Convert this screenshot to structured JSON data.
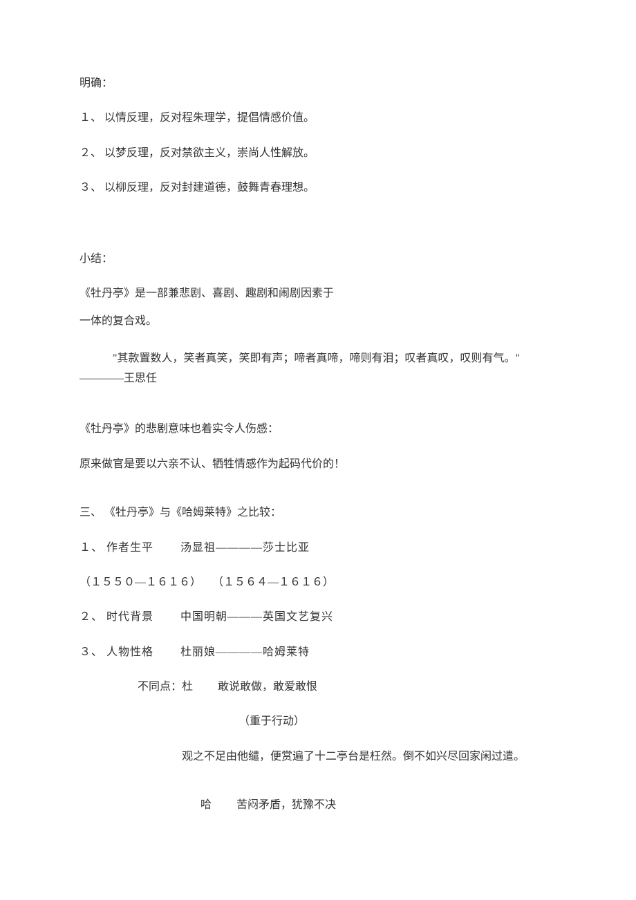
{
  "lines": {
    "l1": "明确：",
    "l2": "１、 以情反理，反对程朱理学，提倡情感价值。",
    "l3": "２、 以梦反理，反对禁欲主义，崇尚人性解放。",
    "l4": "３、 以柳反理，反对封建道德，鼓舞青春理想。",
    "l5": "小结：",
    "l6": "《牡丹亭》是一部兼悲剧、喜剧、趣剧和闹剧因素于",
    "l7": "一体的复合戏。",
    "l8": "　　　\"其款置数人，笑者真笑，笑即有声；啼者真啼，啼则有泪；叹者真叹，叹则有气。\"　　　————王思任",
    "l9": "《牡丹亭》的悲剧意味也着实令人伤感：",
    "l10": "原来做官是要以六亲不认、牺牲情感作为起码代价的！",
    "l11": "三、 《牡丹亭》与《哈姆莱特》之比较：",
    "l12": "１、 作者生平　　 汤显祖————莎士比亚",
    "l13": "（１５５０—１６１６）　　（１５６４—１６１６）",
    "l14": "２、 时代背景　　 中国明朝———英国文艺复兴",
    "l15": "３、 人物性格　　 杜丽娘————哈姆莱特",
    "l16": "不同点：杜　　 敢说敢做，敢爱敢恨",
    "l17": "（重于行动）",
    "l18": "观之不足由他缱，便赏遍了十二亭台是枉然。倒不如兴尽回家闲过遣。",
    "l19": "哈　　 苦闷矛盾，犹豫不决"
  }
}
